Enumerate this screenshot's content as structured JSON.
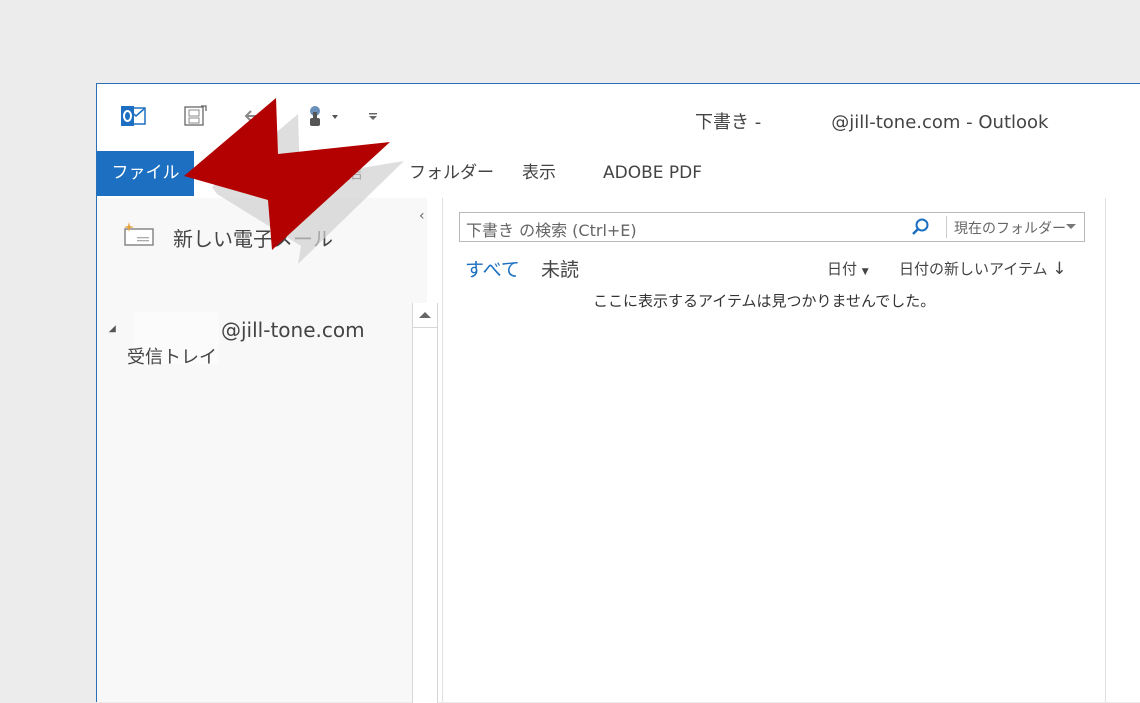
{
  "window": {
    "title_prefix": "下書き -",
    "title_account": "@jill-tone.com - Outlook"
  },
  "quick_access": {
    "icons": [
      "outlook-icon",
      "send-receive-icon",
      "undo-icon",
      "touch-mode-icon",
      "customize-icon"
    ]
  },
  "ribbon": {
    "tabs": [
      {
        "label": "ファイル"
      },
      {
        "label": "送受信"
      },
      {
        "label": "フォルダー"
      },
      {
        "label": "表示"
      },
      {
        "label": "ADOBE PDF"
      }
    ]
  },
  "nav": {
    "new_mail_label": "新しい電子メール",
    "account_name": "@jill-tone.com",
    "inbox_label": "受信トレイ"
  },
  "list": {
    "search_placeholder": "下書き の検索 (Ctrl+E)",
    "search_scope": "現在のフォルダー",
    "filters": [
      "すべて",
      "未読"
    ],
    "sort_by": "日付",
    "sort_order": "日付の新しいアイテム",
    "empty_message": "ここに表示するアイテムは見つかりませんでした。"
  },
  "colors": {
    "accent": "#1c6fc1",
    "arrow": "#b30000"
  }
}
